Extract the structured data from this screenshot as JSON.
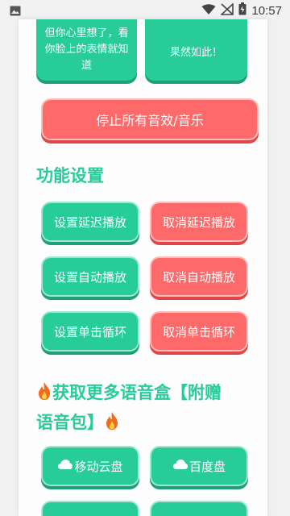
{
  "status_bar": {
    "time": "10:57"
  },
  "top_buttons": [
    {
      "label": "但你心里想了，看你脸上的表情就知道"
    },
    {
      "label": "果然如此！"
    }
  ],
  "stop_all_label": "停止所有音效/音乐",
  "settings": {
    "title": "功能设置",
    "buttons": [
      {
        "label": "设置延迟播放"
      },
      {
        "label": "取消延迟播放"
      },
      {
        "label": "设置自动播放"
      },
      {
        "label": "取消自动播放"
      },
      {
        "label": "设置单击循环"
      },
      {
        "label": "取消单击循环"
      }
    ]
  },
  "more": {
    "title_line1": "获取更多语音盒【附赠",
    "title_line2": "语音包】",
    "buttons": [
      {
        "label": "移动云盘"
      },
      {
        "label": "百度盘"
      }
    ]
  },
  "colors": {
    "green": "#27cc98",
    "red": "#fe6a6a"
  }
}
